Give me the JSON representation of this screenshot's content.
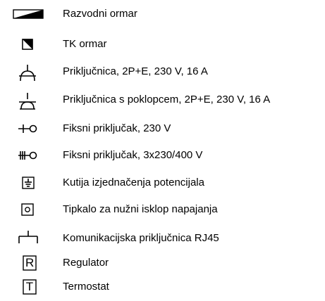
{
  "legend": {
    "items": [
      {
        "icon": "distribution-cabinet-icon",
        "label": "Razvodni ormar"
      },
      {
        "icon": "telecom-cabinet-icon",
        "label": "TK ormar"
      },
      {
        "icon": "socket-icon",
        "label": "Priključnica, 2P+E, 230 V, 16 A"
      },
      {
        "icon": "covered-socket-icon",
        "label": "Priključnica s poklopcem, 2P+E, 230 V, 16 A"
      },
      {
        "icon": "fixed-connection-icon",
        "label": "Fiksni priključak, 230 V"
      },
      {
        "icon": "fixed-connection-three-phase-icon",
        "label": "Fiksni priključak, 3x230/400 V"
      },
      {
        "icon": "equipotential-box-icon",
        "label": "Kutija izjednačenja potencijala"
      },
      {
        "icon": "emergency-stop-button-icon",
        "label": "Tipkalo za nužni isklop napajanja"
      },
      {
        "icon": "rj45-socket-icon",
        "label": "Komunikacijska priključnica RJ45"
      },
      {
        "icon": "regulator-icon",
        "symbol_letter": "R",
        "label": "Regulator"
      },
      {
        "icon": "thermostat-icon",
        "symbol_letter": "T",
        "label": "Termostat"
      }
    ]
  },
  "colors": {
    "symbol": "#000000",
    "text": "#000000",
    "background": "#ffffff"
  }
}
